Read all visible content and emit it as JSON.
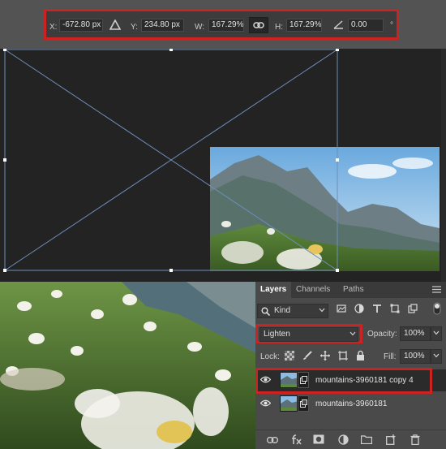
{
  "options_bar": {
    "x_label": "X:",
    "x_value": "-672.80 px",
    "y_label": "Y:",
    "y_value": "234.80 px",
    "w_label": "W:",
    "w_value": "167.29%",
    "h_label": "H:",
    "h_value": "167.29%",
    "angle_value": "0.00",
    "degree_symbol": "°",
    "icons": [
      "reference-point-icon",
      "link-icon",
      "angle-icon"
    ]
  },
  "layers_panel": {
    "tabs": [
      {
        "label": "Layers",
        "active": true
      },
      {
        "label": "Channels",
        "active": false
      },
      {
        "label": "Paths",
        "active": false
      }
    ],
    "filter_kind": "Kind",
    "blend_mode": "Lighten",
    "opacity_label": "Opacity:",
    "opacity_value": "100%",
    "lock_label": "Lock:",
    "fill_label": "Fill:",
    "fill_value": "100%",
    "layers": [
      {
        "name": "mountains-3960181 copy 4",
        "visible": true,
        "selected": true
      },
      {
        "name": "mountains-3960181",
        "visible": true,
        "selected": false
      }
    ],
    "footer_icons": [
      "link-layers-icon",
      "fx-icon",
      "mask-icon",
      "adjustment-icon",
      "folder-icon",
      "new-layer-icon",
      "trash-icon"
    ]
  },
  "colors": {
    "highlight": "#cc2222",
    "panel_bg": "#4a4a4a",
    "canvas_bg": "#232323",
    "transform_line": "#6e8fb8"
  }
}
